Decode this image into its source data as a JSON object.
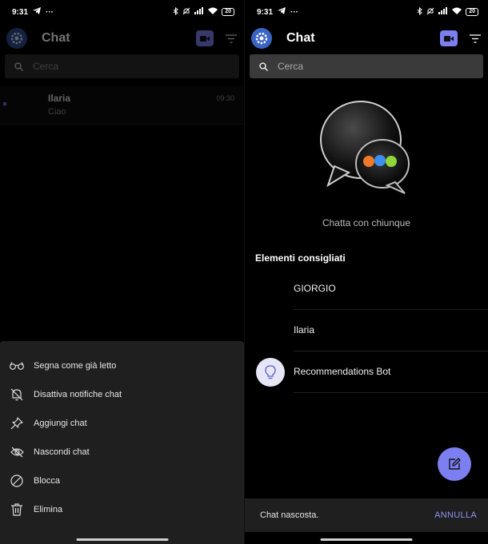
{
  "status": {
    "time": "9:31",
    "battery": "20"
  },
  "left": {
    "header": {
      "title": "Chat"
    },
    "search": {
      "placeholder": "Cerca"
    },
    "chat": {
      "name": "Ilaria",
      "preview": "Ciao",
      "time": "09:30"
    },
    "actions": [
      {
        "label": "Segna come già letto",
        "icon": "glasses-icon"
      },
      {
        "label": "Disattiva notifiche chat",
        "icon": "bell-off-icon"
      },
      {
        "label": "Aggiungi chat",
        "icon": "pin-icon"
      },
      {
        "label": "Nascondi chat",
        "icon": "eye-off-icon"
      },
      {
        "label": "Blocca",
        "icon": "block-icon"
      },
      {
        "label": "Elimina",
        "icon": "trash-icon"
      }
    ]
  },
  "right": {
    "header": {
      "title": "Chat"
    },
    "search": {
      "placeholder": "Cerca"
    },
    "hero_caption": "Chatta con chiunque",
    "section_title": "Elementi consigliati",
    "suggestions": [
      {
        "name": "GIORGIO"
      },
      {
        "name": "Ilaria"
      },
      {
        "name": "Recommendations Bot",
        "icon": "lightbulb-icon"
      }
    ],
    "snackbar": {
      "text": "Chat nascosta.",
      "action": "ANNULLA"
    }
  },
  "colors": {
    "accent": "#7b7ff0",
    "background": "#000000",
    "sheet": "#1f1f1f",
    "search": "#2a2a2a"
  }
}
